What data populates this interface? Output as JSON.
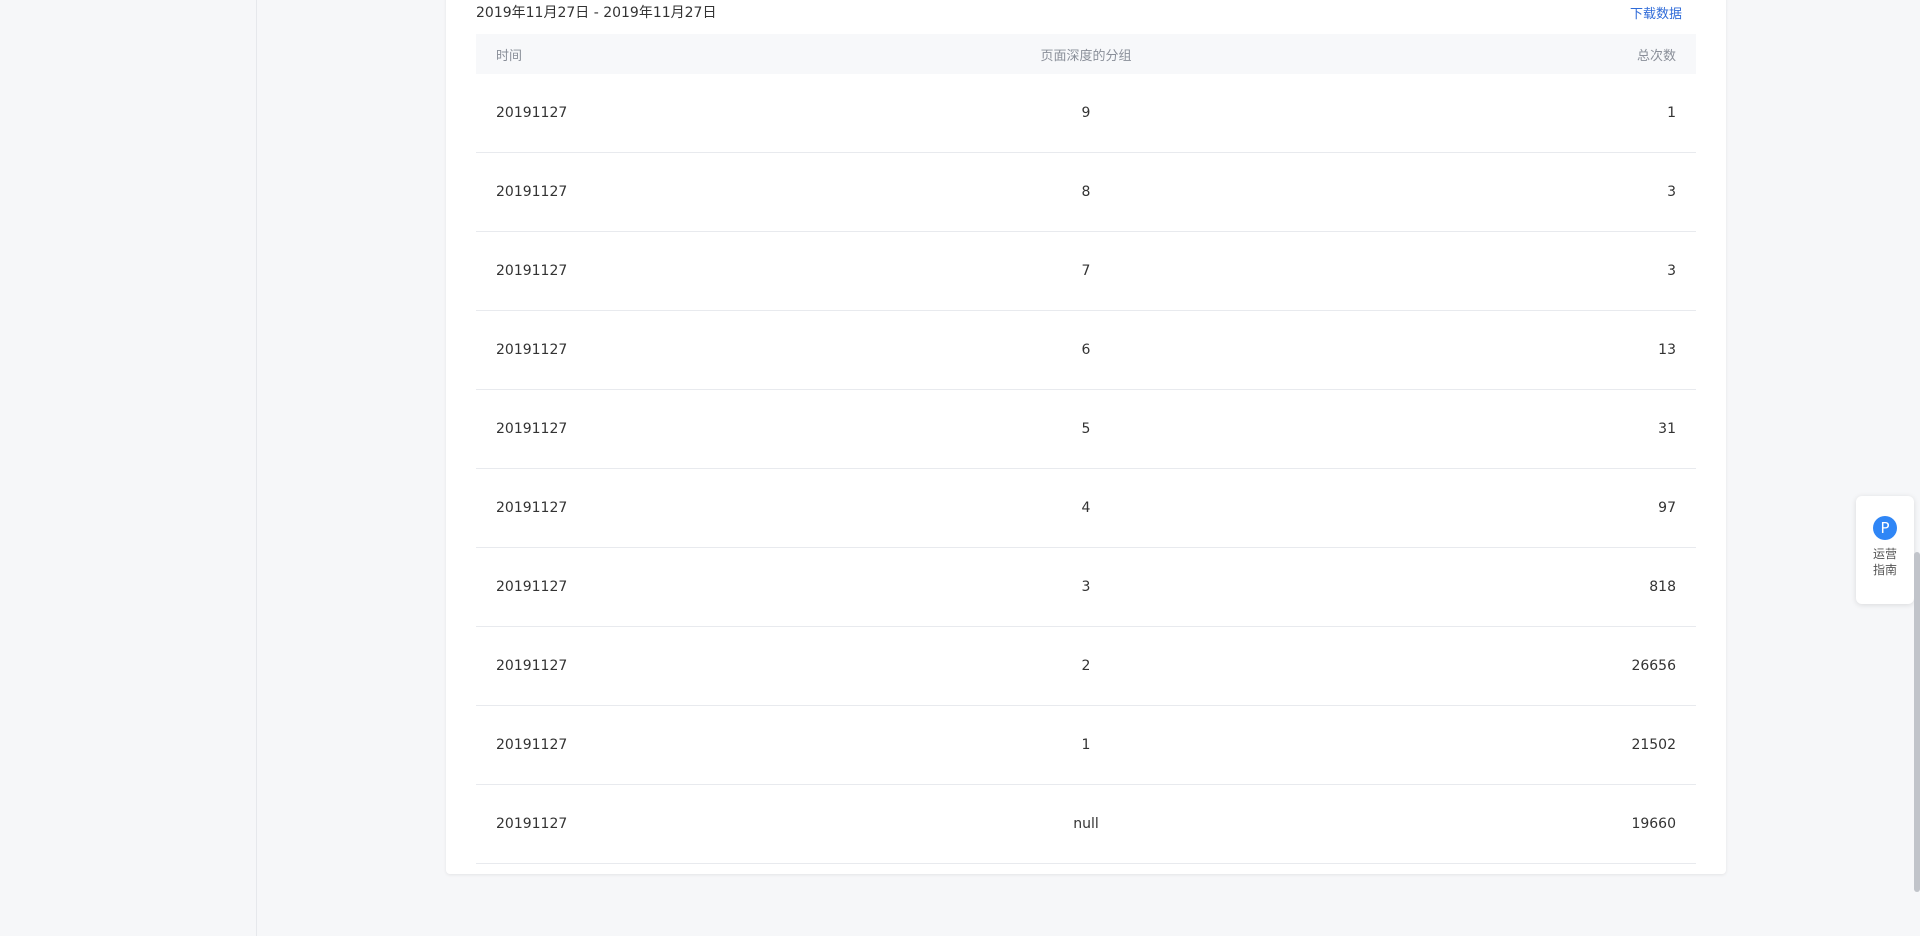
{
  "header": {
    "date_range": "2019年11月27日 - 2019年11月27日",
    "download_label": "下载数据"
  },
  "table": {
    "columns": [
      "时间",
      "页面深度的分组",
      "总次数"
    ],
    "rows": [
      [
        "20191127",
        "9",
        "1"
      ],
      [
        "20191127",
        "8",
        "3"
      ],
      [
        "20191127",
        "7",
        "3"
      ],
      [
        "20191127",
        "6",
        "13"
      ],
      [
        "20191127",
        "5",
        "31"
      ],
      [
        "20191127",
        "4",
        "97"
      ],
      [
        "20191127",
        "3",
        "818"
      ],
      [
        "20191127",
        "2",
        "26656"
      ],
      [
        "20191127",
        "1",
        "21502"
      ],
      [
        "20191127",
        "null",
        "19660"
      ]
    ]
  },
  "float_help": {
    "icon_letter": "P",
    "label": "运营指南",
    "icon_color": "#2f86f6"
  },
  "colors": {
    "link": "#2f6bd8",
    "background": "#f6f7f9",
    "header_bg": "#f7f8fa"
  }
}
